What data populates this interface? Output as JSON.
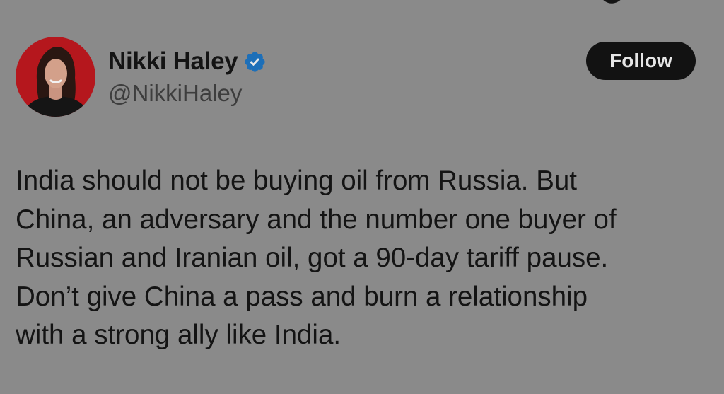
{
  "author": {
    "display_name": "Nikki Haley",
    "handle": "@NikkiHaley",
    "verified": true,
    "avatar_icon": "profile-photo"
  },
  "actions": {
    "follow_label": "Follow"
  },
  "tweet": {
    "lines": [
      "India should not be buying oil from Russia. But",
      "China, an adversary and the number one buyer of",
      "Russian and Iranian oil, got a 90-day tariff pause.",
      "Don’t give China a pass and burn a relationship",
      "with a strong ally like India."
    ]
  },
  "colors": {
    "background": "#8a8a8a",
    "verified_badge": "#1d6fb8",
    "follow_button_bg": "#121212",
    "avatar_bg": "#b5171d"
  }
}
